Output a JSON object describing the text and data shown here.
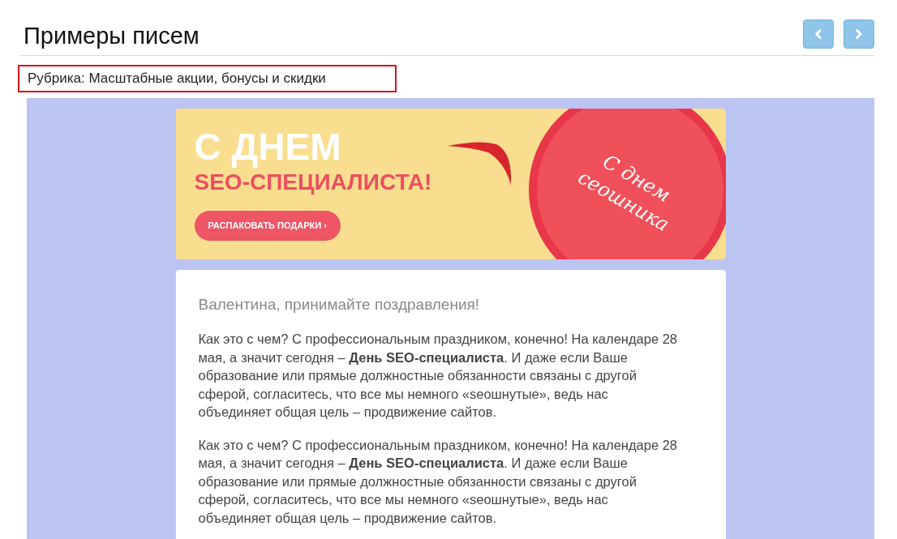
{
  "page_title": "Примеры писем",
  "nav_buttons": [
    {
      "kind": "prev"
    },
    {
      "kind": "next"
    }
  ],
  "category": "Рубрика: Масштабные акции, бонусы и скидки",
  "email": {
    "banner": {
      "headline": "С ДНЕМ",
      "subheadline": "SEO-СПЕЦИАЛИСТА!",
      "button": "РАСПАКОВАТЬ ПОДАРКИ ›",
      "cake_text": "С днем сеошника"
    },
    "greeting": "Валентина, принимайте поздравления!",
    "paragraphs": [
      "Как это с чем? С профессиональным праздником, конечно! На календаре 28 мая, а значит сегодня – **День SEO-специалиста**. И даже если Ваше образование или прямые должностные обязанности связаны с другой сферой, согласитесь, что все мы немного «seoшнутые», ведь нас объединяет общая цель – продвижение сайтов.",
      "Как это с чем? С профессиональным праздником, конечно! На календаре 28 мая, а значит сегодня – **День SEO-специалиста**. И даже если Ваше образование или прямые должностные обязанности связаны с другой сферой, согласитесь, что все мы немного «seoшнутые», ведь нас объединяет общая цель – продвижение сайтов."
    ]
  }
}
